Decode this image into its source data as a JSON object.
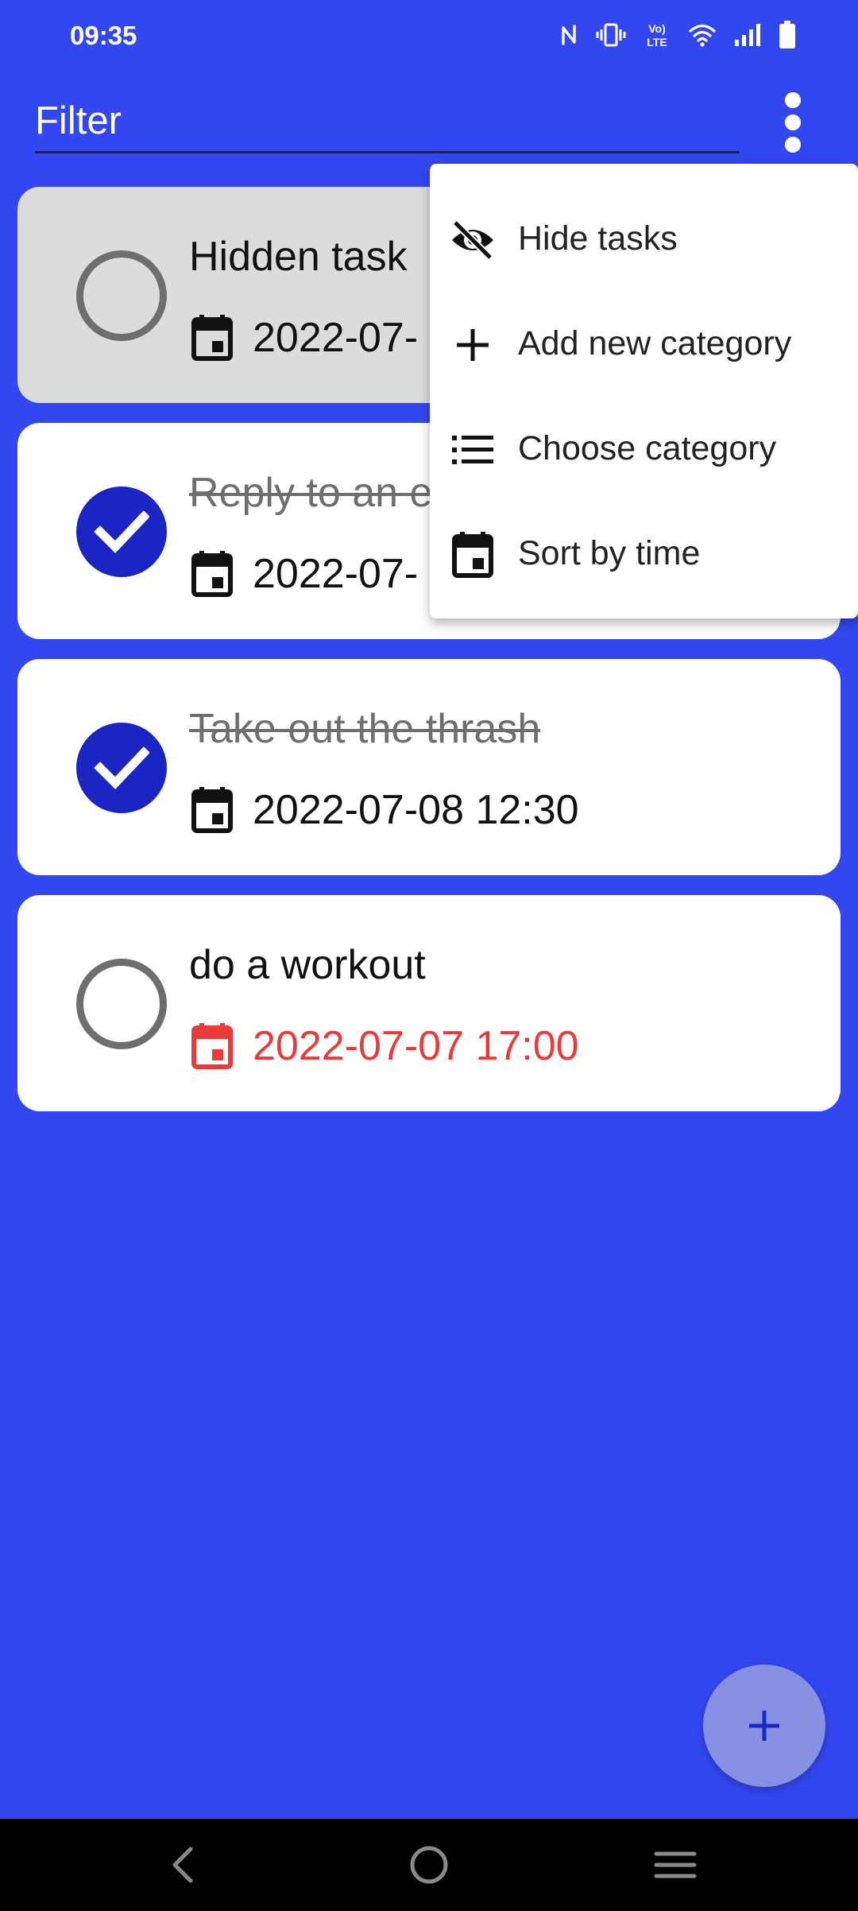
{
  "status_bar": {
    "time": "09:35",
    "icons": [
      "nfc-icon",
      "vibrate-icon",
      "volte-icon",
      "wifi-icon",
      "signal-icon",
      "battery-icon"
    ],
    "volte_line1": "Vo)",
    "volte_line2": "LTE"
  },
  "toolbar": {
    "filter_placeholder": "Filter",
    "overflow_icon": "more-vertical-icon"
  },
  "tasks": [
    {
      "title": "Hidden task",
      "date": "2022-07-",
      "completed": false,
      "hidden": true,
      "overdue": false
    },
    {
      "title": "Reply to an e",
      "date": "2022-07-",
      "completed": true,
      "hidden": false,
      "overdue": false
    },
    {
      "title": "Take out the thrash",
      "date": "2022-07-08 12:30",
      "completed": true,
      "hidden": false,
      "overdue": false
    },
    {
      "title": "do a workout",
      "date": "2022-07-07 17:00",
      "completed": false,
      "hidden": false,
      "overdue": true
    }
  ],
  "menu": {
    "items": [
      {
        "label": "Hide tasks",
        "icon": "eye-off-icon"
      },
      {
        "label": "Add new category",
        "icon": "plus-icon"
      },
      {
        "label": "Choose category",
        "icon": "list-icon"
      },
      {
        "label": "Sort by time",
        "icon": "calendar-icon"
      }
    ]
  },
  "fab": {
    "icon": "plus-icon"
  },
  "nav_bar": {
    "items": [
      "back-icon",
      "home-icon",
      "menu-icon"
    ]
  },
  "colors": {
    "background": "#3347F0",
    "checked": "#1A25C4",
    "overdue": "#EB3A3A",
    "hidden_card": "#DCDCDC",
    "fab": "#8791E4"
  }
}
